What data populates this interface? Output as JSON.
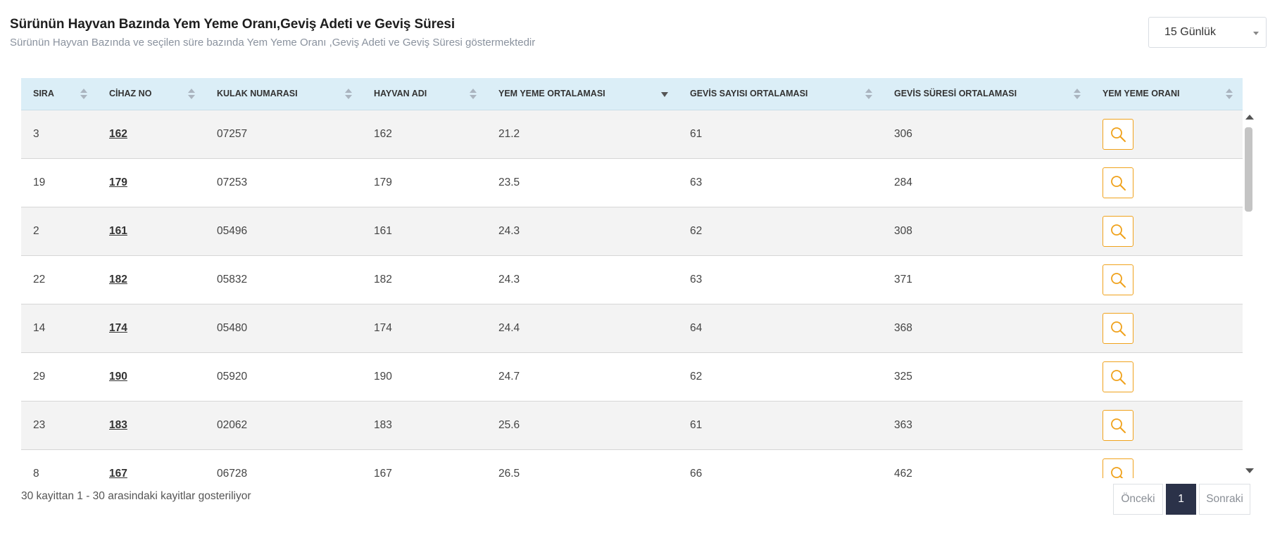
{
  "header": {
    "title": "Sürünün Hayvan Bazında Yem Yeme Oranı,Geviş Adeti ve Geviş Süresi",
    "subtitle": "Sürünün Hayvan Bazında ve seçilen süre bazında Yem Yeme Oranı ,Geviş Adeti ve Geviş Süresi göstermektedir",
    "period_value": "15 Günlük"
  },
  "table": {
    "columns": [
      "SIRA",
      "CİHAZ NO",
      "KULAK NUMARASI",
      "HAYVAN ADI",
      "YEM YEME ORTALAMASI",
      "GEVİS SAYISI ORTALAMASI",
      "GEVİS SÜRESİ ORTALAMASI",
      "YEM YEME ORANI"
    ],
    "sorted_column": "YEM YEME ORTALAMASI",
    "rows": [
      {
        "sira": "3",
        "cihaz": "162",
        "kulak": "07257",
        "hayvan": "162",
        "yem": "21.2",
        "gevis_sayi": "61",
        "gevis_sure": "306"
      },
      {
        "sira": "19",
        "cihaz": "179",
        "kulak": "07253",
        "hayvan": "179",
        "yem": "23.5",
        "gevis_sayi": "63",
        "gevis_sure": "284"
      },
      {
        "sira": "2",
        "cihaz": "161",
        "kulak": "05496",
        "hayvan": "161",
        "yem": "24.3",
        "gevis_sayi": "62",
        "gevis_sure": "308"
      },
      {
        "sira": "22",
        "cihaz": "182",
        "kulak": "05832",
        "hayvan": "182",
        "yem": "24.3",
        "gevis_sayi": "63",
        "gevis_sure": "371"
      },
      {
        "sira": "14",
        "cihaz": "174",
        "kulak": "05480",
        "hayvan": "174",
        "yem": "24.4",
        "gevis_sayi": "64",
        "gevis_sure": "368"
      },
      {
        "sira": "29",
        "cihaz": "190",
        "kulak": "05920",
        "hayvan": "190",
        "yem": "24.7",
        "gevis_sayi": "62",
        "gevis_sure": "325"
      },
      {
        "sira": "23",
        "cihaz": "183",
        "kulak": "02062",
        "hayvan": "183",
        "yem": "25.6",
        "gevis_sayi": "61",
        "gevis_sure": "363"
      },
      {
        "sira": "8",
        "cihaz": "167",
        "kulak": "06728",
        "hayvan": "167",
        "yem": "26.5",
        "gevis_sayi": "66",
        "gevis_sure": "462"
      }
    ]
  },
  "footer": {
    "info": "30 kayittan 1 - 30 arasindaki kayitlar gosteriliyor",
    "prev_label": "Önceki",
    "current_page": "1",
    "next_label": "Sonraki"
  },
  "colors": {
    "header_bg": "#dbeef7",
    "accent_orange": "#f0a21c",
    "active_page": "#2b3249"
  }
}
